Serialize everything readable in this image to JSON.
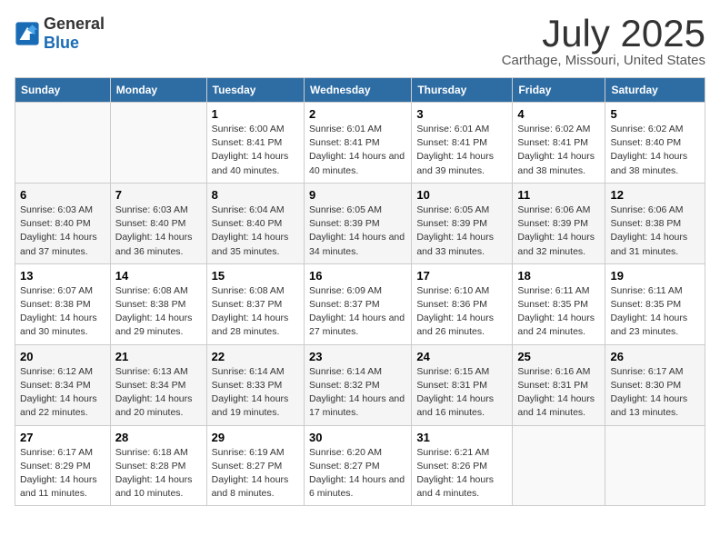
{
  "header": {
    "logo_general": "General",
    "logo_blue": "Blue",
    "title": "July 2025",
    "subtitle": "Carthage, Missouri, United States"
  },
  "weekdays": [
    "Sunday",
    "Monday",
    "Tuesday",
    "Wednesday",
    "Thursday",
    "Friday",
    "Saturday"
  ],
  "weeks": [
    [
      {
        "day": "",
        "sunrise": "",
        "sunset": "",
        "daylight": ""
      },
      {
        "day": "",
        "sunrise": "",
        "sunset": "",
        "daylight": ""
      },
      {
        "day": "1",
        "sunrise": "Sunrise: 6:00 AM",
        "sunset": "Sunset: 8:41 PM",
        "daylight": "Daylight: 14 hours and 40 minutes."
      },
      {
        "day": "2",
        "sunrise": "Sunrise: 6:01 AM",
        "sunset": "Sunset: 8:41 PM",
        "daylight": "Daylight: 14 hours and 40 minutes."
      },
      {
        "day": "3",
        "sunrise": "Sunrise: 6:01 AM",
        "sunset": "Sunset: 8:41 PM",
        "daylight": "Daylight: 14 hours and 39 minutes."
      },
      {
        "day": "4",
        "sunrise": "Sunrise: 6:02 AM",
        "sunset": "Sunset: 8:41 PM",
        "daylight": "Daylight: 14 hours and 38 minutes."
      },
      {
        "day": "5",
        "sunrise": "Sunrise: 6:02 AM",
        "sunset": "Sunset: 8:40 PM",
        "daylight": "Daylight: 14 hours and 38 minutes."
      }
    ],
    [
      {
        "day": "6",
        "sunrise": "Sunrise: 6:03 AM",
        "sunset": "Sunset: 8:40 PM",
        "daylight": "Daylight: 14 hours and 37 minutes."
      },
      {
        "day": "7",
        "sunrise": "Sunrise: 6:03 AM",
        "sunset": "Sunset: 8:40 PM",
        "daylight": "Daylight: 14 hours and 36 minutes."
      },
      {
        "day": "8",
        "sunrise": "Sunrise: 6:04 AM",
        "sunset": "Sunset: 8:40 PM",
        "daylight": "Daylight: 14 hours and 35 minutes."
      },
      {
        "day": "9",
        "sunrise": "Sunrise: 6:05 AM",
        "sunset": "Sunset: 8:39 PM",
        "daylight": "Daylight: 14 hours and 34 minutes."
      },
      {
        "day": "10",
        "sunrise": "Sunrise: 6:05 AM",
        "sunset": "Sunset: 8:39 PM",
        "daylight": "Daylight: 14 hours and 33 minutes."
      },
      {
        "day": "11",
        "sunrise": "Sunrise: 6:06 AM",
        "sunset": "Sunset: 8:39 PM",
        "daylight": "Daylight: 14 hours and 32 minutes."
      },
      {
        "day": "12",
        "sunrise": "Sunrise: 6:06 AM",
        "sunset": "Sunset: 8:38 PM",
        "daylight": "Daylight: 14 hours and 31 minutes."
      }
    ],
    [
      {
        "day": "13",
        "sunrise": "Sunrise: 6:07 AM",
        "sunset": "Sunset: 8:38 PM",
        "daylight": "Daylight: 14 hours and 30 minutes."
      },
      {
        "day": "14",
        "sunrise": "Sunrise: 6:08 AM",
        "sunset": "Sunset: 8:38 PM",
        "daylight": "Daylight: 14 hours and 29 minutes."
      },
      {
        "day": "15",
        "sunrise": "Sunrise: 6:08 AM",
        "sunset": "Sunset: 8:37 PM",
        "daylight": "Daylight: 14 hours and 28 minutes."
      },
      {
        "day": "16",
        "sunrise": "Sunrise: 6:09 AM",
        "sunset": "Sunset: 8:37 PM",
        "daylight": "Daylight: 14 hours and 27 minutes."
      },
      {
        "day": "17",
        "sunrise": "Sunrise: 6:10 AM",
        "sunset": "Sunset: 8:36 PM",
        "daylight": "Daylight: 14 hours and 26 minutes."
      },
      {
        "day": "18",
        "sunrise": "Sunrise: 6:11 AM",
        "sunset": "Sunset: 8:35 PM",
        "daylight": "Daylight: 14 hours and 24 minutes."
      },
      {
        "day": "19",
        "sunrise": "Sunrise: 6:11 AM",
        "sunset": "Sunset: 8:35 PM",
        "daylight": "Daylight: 14 hours and 23 minutes."
      }
    ],
    [
      {
        "day": "20",
        "sunrise": "Sunrise: 6:12 AM",
        "sunset": "Sunset: 8:34 PM",
        "daylight": "Daylight: 14 hours and 22 minutes."
      },
      {
        "day": "21",
        "sunrise": "Sunrise: 6:13 AM",
        "sunset": "Sunset: 8:34 PM",
        "daylight": "Daylight: 14 hours and 20 minutes."
      },
      {
        "day": "22",
        "sunrise": "Sunrise: 6:14 AM",
        "sunset": "Sunset: 8:33 PM",
        "daylight": "Daylight: 14 hours and 19 minutes."
      },
      {
        "day": "23",
        "sunrise": "Sunrise: 6:14 AM",
        "sunset": "Sunset: 8:32 PM",
        "daylight": "Daylight: 14 hours and 17 minutes."
      },
      {
        "day": "24",
        "sunrise": "Sunrise: 6:15 AM",
        "sunset": "Sunset: 8:31 PM",
        "daylight": "Daylight: 14 hours and 16 minutes."
      },
      {
        "day": "25",
        "sunrise": "Sunrise: 6:16 AM",
        "sunset": "Sunset: 8:31 PM",
        "daylight": "Daylight: 14 hours and 14 minutes."
      },
      {
        "day": "26",
        "sunrise": "Sunrise: 6:17 AM",
        "sunset": "Sunset: 8:30 PM",
        "daylight": "Daylight: 14 hours and 13 minutes."
      }
    ],
    [
      {
        "day": "27",
        "sunrise": "Sunrise: 6:17 AM",
        "sunset": "Sunset: 8:29 PM",
        "daylight": "Daylight: 14 hours and 11 minutes."
      },
      {
        "day": "28",
        "sunrise": "Sunrise: 6:18 AM",
        "sunset": "Sunset: 8:28 PM",
        "daylight": "Daylight: 14 hours and 10 minutes."
      },
      {
        "day": "29",
        "sunrise": "Sunrise: 6:19 AM",
        "sunset": "Sunset: 8:27 PM",
        "daylight": "Daylight: 14 hours and 8 minutes."
      },
      {
        "day": "30",
        "sunrise": "Sunrise: 6:20 AM",
        "sunset": "Sunset: 8:27 PM",
        "daylight": "Daylight: 14 hours and 6 minutes."
      },
      {
        "day": "31",
        "sunrise": "Sunrise: 6:21 AM",
        "sunset": "Sunset: 8:26 PM",
        "daylight": "Daylight: 14 hours and 4 minutes."
      },
      {
        "day": "",
        "sunrise": "",
        "sunset": "",
        "daylight": ""
      },
      {
        "day": "",
        "sunrise": "",
        "sunset": "",
        "daylight": ""
      }
    ]
  ]
}
